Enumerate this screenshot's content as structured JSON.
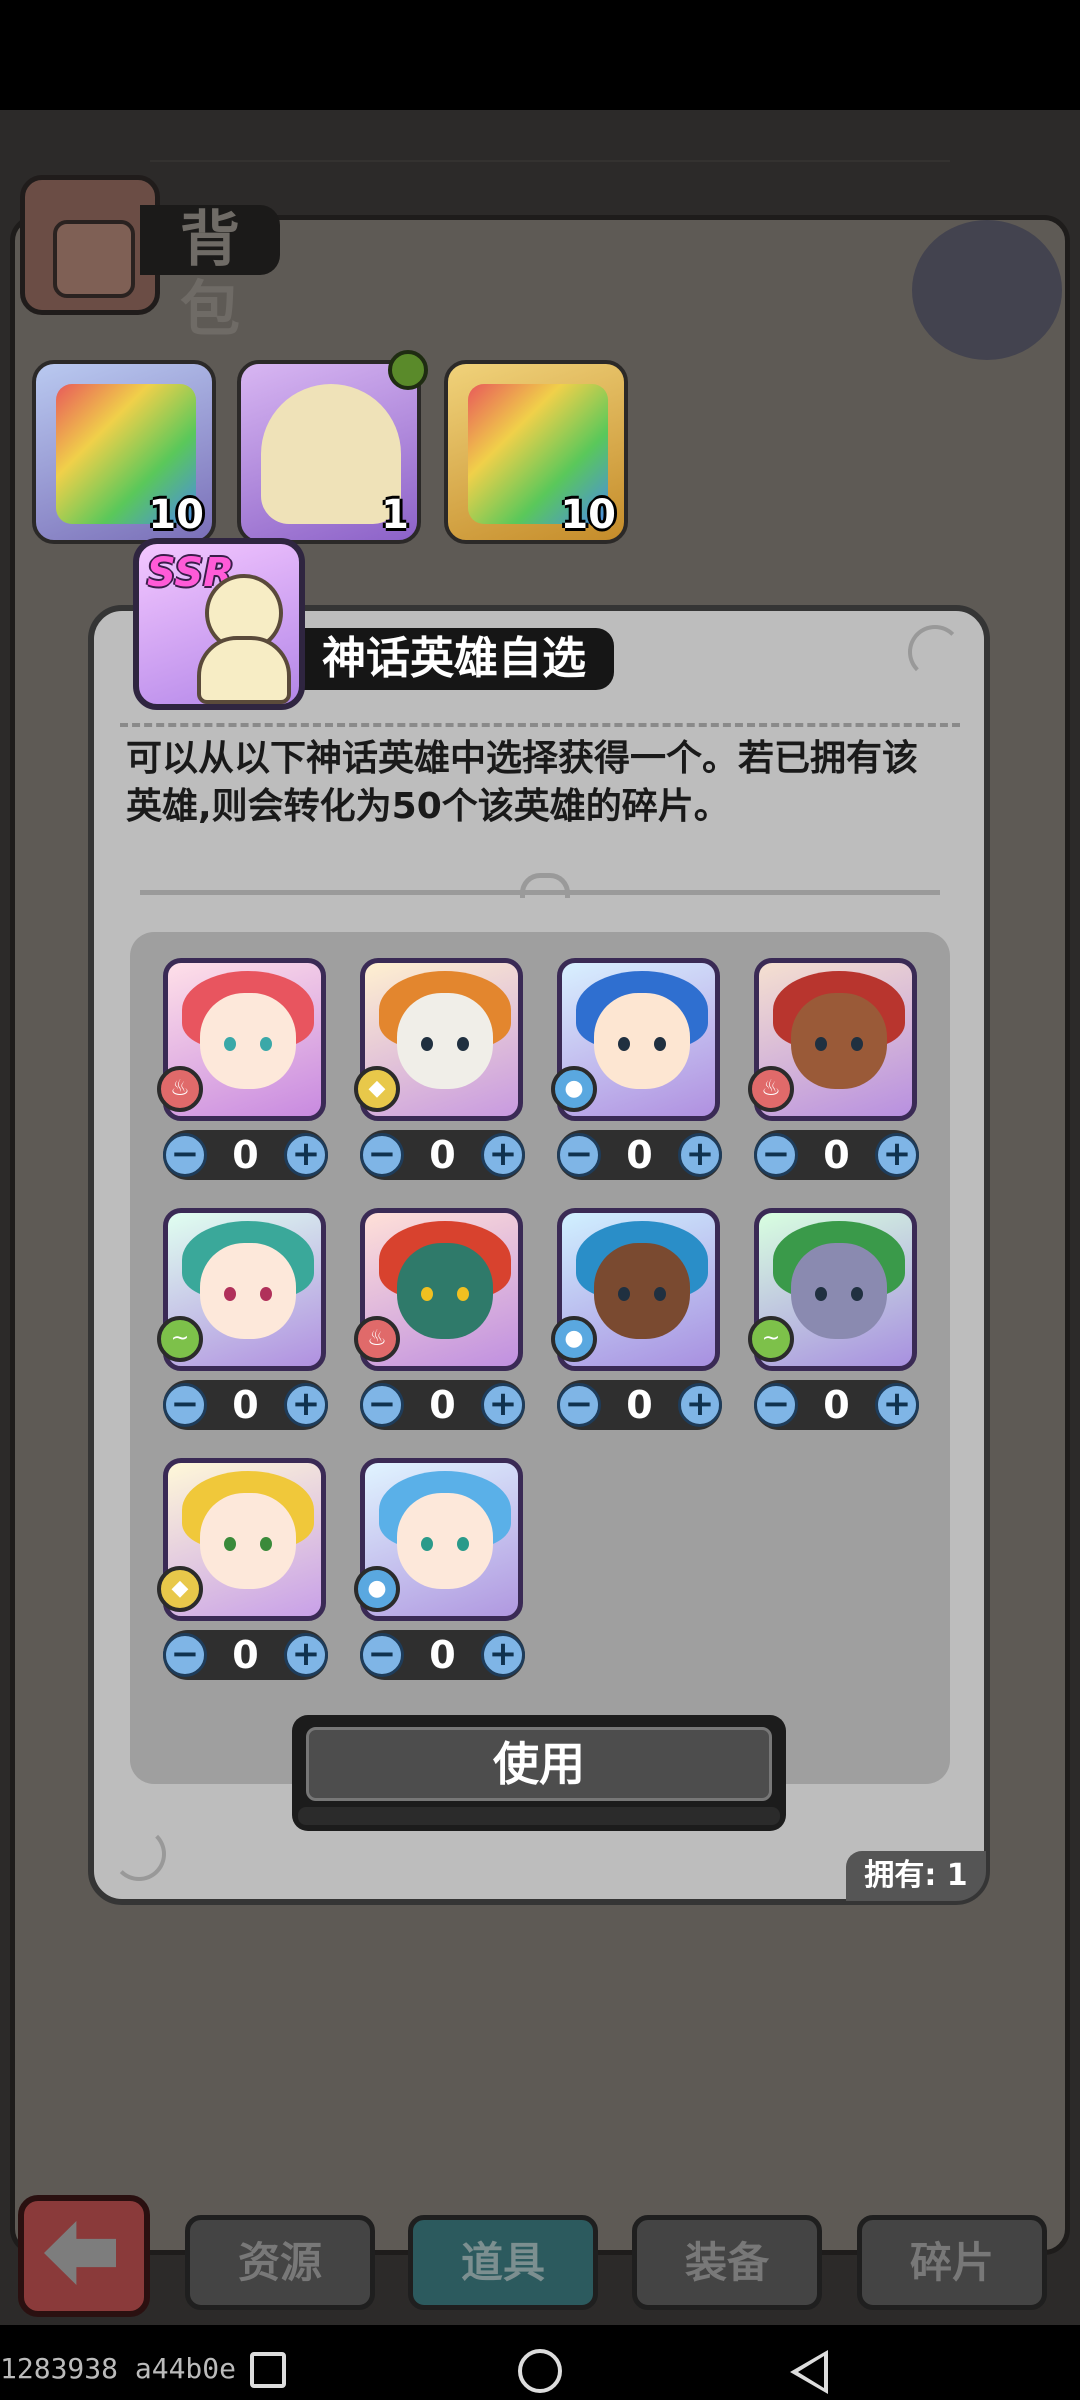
{
  "bag": {
    "title": "背包"
  },
  "inventory": [
    {
      "icon": "rainbow-book-hand-icon",
      "count": "10"
    },
    {
      "icon": "ssr-hero-select-icon",
      "count": "1"
    },
    {
      "icon": "gold-book-hand-icon",
      "count": "10"
    }
  ],
  "modal": {
    "title": "神话英雄自选",
    "badge": "SSR",
    "description_line1": "可以从以下神话英雄中选择获得一个。若已拥有该",
    "description_line2": "英雄,则会转化为50个该英雄的碎片。",
    "use_button": "使用",
    "owned": "拥有: 1"
  },
  "heroes": [
    {
      "element": "fire-element-icon",
      "quantity": "0"
    },
    {
      "element": "earth-element-icon",
      "quantity": "0"
    },
    {
      "element": "water-element-icon",
      "quantity": "0"
    },
    {
      "element": "fire-element-icon",
      "quantity": "0"
    },
    {
      "element": "wind-element-icon",
      "quantity": "0"
    },
    {
      "element": "fire-element-icon",
      "quantity": "0"
    },
    {
      "element": "water-element-icon",
      "quantity": "0"
    },
    {
      "element": "wind-element-icon",
      "quantity": "0"
    },
    {
      "element": "earth-element-icon",
      "quantity": "0"
    },
    {
      "element": "water-element-icon",
      "quantity": "0"
    }
  ],
  "tabs": [
    {
      "label": "资源"
    },
    {
      "label": "道具",
      "active": true
    },
    {
      "label": "装备"
    },
    {
      "label": "碎片"
    }
  ],
  "system": {
    "build_id": "1283938 a44b0e"
  },
  "colors": {
    "modal_bg": "#bdbdbd",
    "stepper_blue": "#7fb5e6",
    "fire": "#e06a6a",
    "earth": "#e8c84a",
    "water": "#5aa8e0",
    "wind": "#7dc14a"
  }
}
